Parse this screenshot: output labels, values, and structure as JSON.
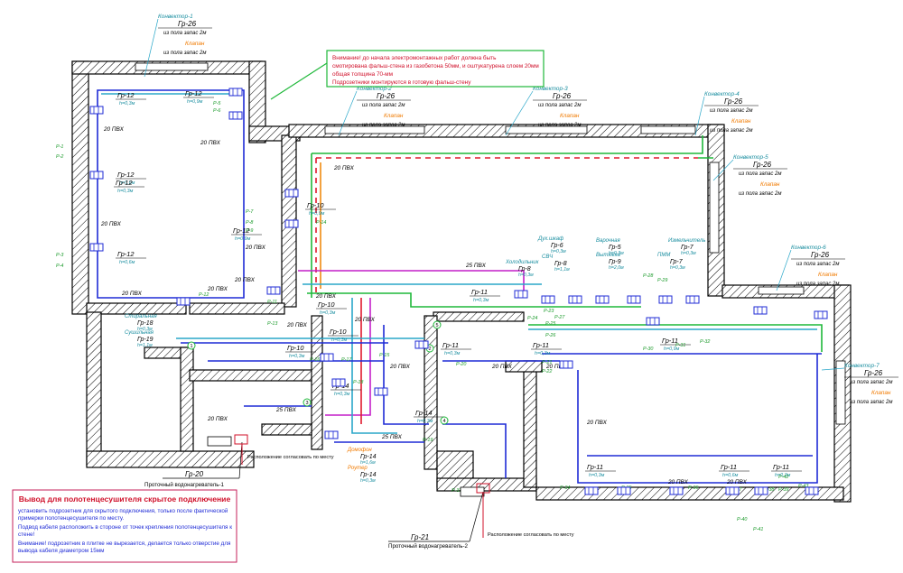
{
  "notices": {
    "top": {
      "lines": [
        "Внимание! до начала электромонтажных работ должна быть",
        "смотирована фальш-стена из газобетона 50мм, и оштукатурена слоем 20мм",
        "общая толщина 70-мм",
        "Подрозетники монтируются в готовую фальш-стену"
      ]
    },
    "bottom": {
      "title": "Вывод для полотенцесушителя скрытое подключение",
      "lines": [
        "установить подрозетник для скрытого подключения, только после фактической",
        "примерки полотенцесушителя по месту.",
        "Подвод кабеля расположить в стороне от точек крепления полотенцесушителя к",
        "стене!",
        "Внимание! подрозетник в плитке не вырезается, делается только отверстие для",
        "вывода кабеля диаметром 15мм"
      ]
    }
  },
  "convectors": [
    {
      "name": "Конвектор-1",
      "group": "Гр-26",
      "note": "из пола запас 2м",
      "valve": "Клапан"
    },
    {
      "name": "Конвектор-2",
      "group": "Гр-26",
      "note": "из пола запас 2м",
      "valve": "Клапан"
    },
    {
      "name": "Конвектор-3",
      "group": "Гр-26",
      "note": "из пола запас 2м",
      "valve": "Клапан"
    },
    {
      "name": "Конвектор-4",
      "group": "Гр-26",
      "note": "из пола запас 2м",
      "valve": "Клапан"
    },
    {
      "name": "Конвектор-5",
      "group": "Гр-26",
      "note": "из пола запас 2м",
      "valve": "Клапан"
    },
    {
      "name": "Конвектор-6",
      "group": "Гр-26",
      "note": "из пола запас 2м",
      "valve": "Клапан"
    },
    {
      "name": "Конвектор-7",
      "group": "Гр-26",
      "note": "из пола запас 2м",
      "valve": "Клапан"
    }
  ],
  "group_labels": [
    {
      "g": "Гр-12",
      "h": "h=0,3м"
    },
    {
      "g": "Гр-12",
      "h": "h=0,9м"
    },
    {
      "g": "Гр-12",
      "h": "h=0,6м"
    },
    {
      "g": "Гр-12",
      "h": "h=0,6м"
    },
    {
      "g": "Гр-12",
      "h": "h=0,9м"
    },
    {
      "g": "Гр-12",
      "h": "h=0,3м"
    },
    {
      "g": "Гр-10",
      "h": "h=0,9м"
    },
    {
      "g": "Гр-10",
      "h": "h=0,3м"
    },
    {
      "g": "Гр-10",
      "h": "h=0,3м"
    },
    {
      "g": "Гр-10",
      "h": "h=0,3м"
    },
    {
      "g": "Гр-11",
      "h": "h=0,3м"
    },
    {
      "g": "Гр-11",
      "h": "h=0,3м"
    },
    {
      "g": "Гр-11",
      "h": "h=0,3м"
    },
    {
      "g": "Гр-14",
      "h": "h=0,3м"
    },
    {
      "g": "Гр-14",
      "h": "h=0,3м"
    },
    {
      "g": "Гр-11",
      "h": "h=0,3м"
    },
    {
      "g": "Гр-11",
      "h": "h=0,6м"
    },
    {
      "g": "Гр-11",
      "h": "h=0,9м"
    },
    {
      "g": "Гр-11",
      "h": "h=0,3м"
    }
  ],
  "appliances": [
    {
      "name": "Дух.шкаф",
      "g": "Гр-6",
      "h": "h=0,3м"
    },
    {
      "name": "СВЧ",
      "g": "Гр-8",
      "h": "h=1,1м"
    },
    {
      "name": "Холодильник",
      "g": "Гр-8",
      "h": "h=0,3м"
    },
    {
      "name": "Варочная",
      "g": "Гр-5",
      "h": "h=0,3м"
    },
    {
      "name": "Вытяжка",
      "g": "Гр-9",
      "h": "h=2,0м"
    },
    {
      "name": "ПММ",
      "g": "Гр-7",
      "h": "h=0,3м"
    },
    {
      "name": "Измельчитель",
      "g": "Гр-7",
      "h": "h=0,3м"
    },
    {
      "name": "Стиральная",
      "g": "Гр-18",
      "h": "h=0,3м"
    },
    {
      "name": "Сушильная",
      "g": "Гр-19",
      "h": "h=1,1м"
    },
    {
      "name": "Домофон",
      "g": "Гр-14",
      "h": "h=1,6м"
    },
    {
      "name": "Роутер",
      "g": "Гр-14",
      "h": "h=0,3м"
    }
  ],
  "pvc": [
    "20 ПВХ",
    "20 ПВХ",
    "20 ПВХ",
    "20 ПВХ",
    "20 ПВХ",
    "20 ПВХ",
    "25 ПВХ",
    "20 ПВХ",
    "20 ПВХ",
    "20 ПВХ",
    "20 ПВХ",
    "20 ПВХ",
    "25 ПВХ",
    "25 ПВХ",
    "20 ПВХ",
    "20 ПВХ",
    "20 ПВХ",
    "20 ПВХ",
    "20 ПВХ",
    "20 ПВХ",
    "20 ПВХ"
  ],
  "heaters": [
    {
      "g": "Гр-20",
      "name": "Проточный водонагреватель-1"
    },
    {
      "g": "Гр-21",
      "name": "Проточный водонагреватель-2"
    }
  ],
  "placement_note": "Расположение согласовать по месту",
  "r_labels": [
    "Р-1",
    "Р-2",
    "Р-3",
    "Р-4",
    "Р-5",
    "Р-6",
    "Р-7",
    "Р-8",
    "Р-9",
    "Р-10",
    "Р-11",
    "Р-12",
    "Р-13",
    "Р-14",
    "Р-15",
    "Р-16",
    "Р-17",
    "Р-18",
    "Р-19",
    "Р-20",
    "Р-21",
    "Р-22",
    "Р-23",
    "Р-24",
    "Р-25",
    "Р-26",
    "Р-27",
    "Р-28",
    "Р-29",
    "Р-30",
    "Р-31",
    "Р-32",
    "Р-33",
    "Р-34",
    "Р-35",
    "Р-36",
    "Р-37",
    "Р-38",
    "Р-39",
    "Р-40",
    "Р-41",
    "Р-42",
    "Р-43"
  ],
  "junctions": [
    "1",
    "2",
    "3",
    "4",
    "5"
  ],
  "colors": {
    "wall": "#000000",
    "wire_blue": "#1f2bd6",
    "wire_green": "#1fb83a",
    "wire_cyan": "#2aa7c9",
    "wire_red": "#e0192d",
    "wire_orange": "#f08a10",
    "wire_magenta": "#c41fc9",
    "label_green": "#1a9a2a",
    "label_teal": "#1a8ea0",
    "label_orange": "#f07a00",
    "label_red": "#d0102a",
    "notice_border": "#1fb83a",
    "notice_text": "#d0102a"
  }
}
